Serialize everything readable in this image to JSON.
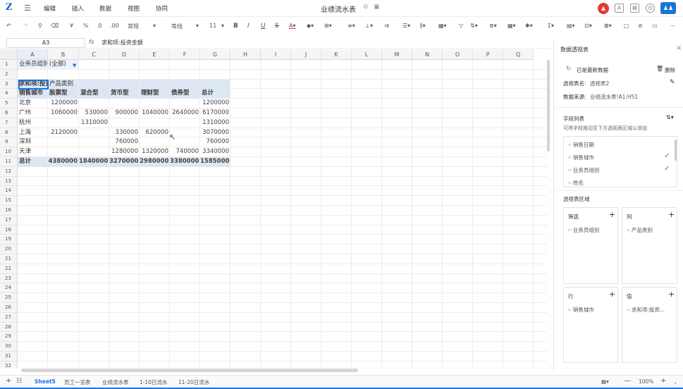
{
  "app": {
    "logo": "Z",
    "title": "业绩流水表",
    "menus": [
      "编辑",
      "插入",
      "数据",
      "视图",
      "协同"
    ]
  },
  "toolbar": {
    "format": "常规",
    "font": "等线",
    "size": "11",
    "bold": "B",
    "italic": "I",
    "underline": "U",
    "strike": "S",
    "currency": "¥",
    "percent": "%"
  },
  "formula_bar": {
    "name_box": "A3",
    "fx": "fx",
    "value": "求和项:投资金额"
  },
  "grid": {
    "columns": [
      "A",
      "B",
      "C",
      "D",
      "E",
      "F",
      "G",
      "H",
      "I",
      "J",
      "K",
      "L",
      "M",
      "N",
      "O",
      "P",
      "Q"
    ],
    "rows": [
      "1",
      "2",
      "3",
      "4",
      "5",
      "6",
      "7",
      "8",
      "9",
      "10",
      "11",
      "12",
      "13",
      "14",
      "15",
      "16",
      "17",
      "18",
      "19",
      "20",
      "21",
      "22",
      "23",
      "24",
      "25",
      "26",
      "27",
      "28",
      "29",
      "30",
      "31",
      "32"
    ],
    "filter_label": "业务员组别",
    "filter_value": "(全部)",
    "sum_label": "求和项:投资金额",
    "product_label": "产品类别",
    "header_row": [
      "销售城市",
      "股票型",
      "混合型",
      "货币型",
      "理财型",
      "债券型",
      "总计"
    ],
    "data_rows": [
      [
        "北京",
        "1200000",
        "",
        "",
        "",
        "",
        "1200000"
      ],
      [
        "广州",
        "1060000",
        "530000",
        "900000",
        "1040000",
        "2640000",
        "6170000"
      ],
      [
        "杭州",
        "",
        "1310000",
        "",
        "",
        "",
        "1310000"
      ],
      [
        "上海",
        "2120000",
        "",
        "330000",
        "620000",
        "",
        "3070000"
      ],
      [
        "深圳",
        "",
        "",
        "760000",
        "",
        "",
        "760000"
      ],
      [
        "天津",
        "",
        "",
        "1280000",
        "1320000",
        "740000",
        "3340000"
      ]
    ],
    "total_row": [
      "总计",
      "4380000",
      "1840000",
      "3270000",
      "2980000",
      "3380000",
      "15850000"
    ]
  },
  "panel": {
    "title": "数据透视表",
    "refreshed": "已是最新数据",
    "delete": "删除",
    "name_label": "透视表名:",
    "name_value": "透视表2",
    "source_label": "数据来源:",
    "source_value": "业绩流水表!A1:H51",
    "field_list_title": "字段列表",
    "field_list_hint": "可将字段拖动至下方透视表区域以添加",
    "fields": [
      {
        "name": "销售日期",
        "checked": false
      },
      {
        "name": "销售城市",
        "checked": true
      },
      {
        "name": "业务员组别",
        "checked": true
      },
      {
        "name": "姓名",
        "checked": false
      }
    ],
    "area_title": "透视表区域",
    "filter_area": {
      "title": "筛选",
      "item": "业务员组别"
    },
    "column_area": {
      "title": "列",
      "item": "产品类别"
    },
    "row_area": {
      "title": "行",
      "item": "销售城市"
    },
    "value_area": {
      "title": "值",
      "item": "求和项:投资..."
    }
  },
  "sheets": [
    "Sheet5",
    "员工一览表",
    "业绩流水表",
    "1-10日流水",
    "11-20日流水"
  ],
  "zoom": "100%"
}
